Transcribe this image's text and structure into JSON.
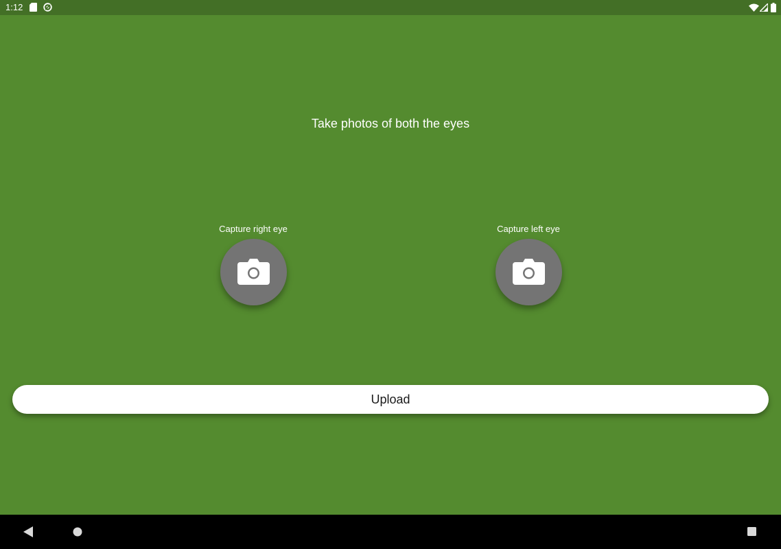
{
  "status_bar": {
    "time": "1:12",
    "icons": [
      "sd-card-icon",
      "sync-icon",
      "wifi-icon",
      "signal-icon",
      "battery-icon"
    ],
    "background": "#436F26"
  },
  "screen": {
    "background": "#548B2F",
    "headline": "Take photos of both the eyes"
  },
  "capture": {
    "right_eye_label": "Capture right eye",
    "left_eye_label": "Capture left eye",
    "button_color": "#747474",
    "icon": "camera-icon"
  },
  "upload": {
    "label": "Upload"
  },
  "nav_bar": {
    "buttons": [
      "back-icon",
      "home-icon",
      "recents-icon"
    ]
  }
}
